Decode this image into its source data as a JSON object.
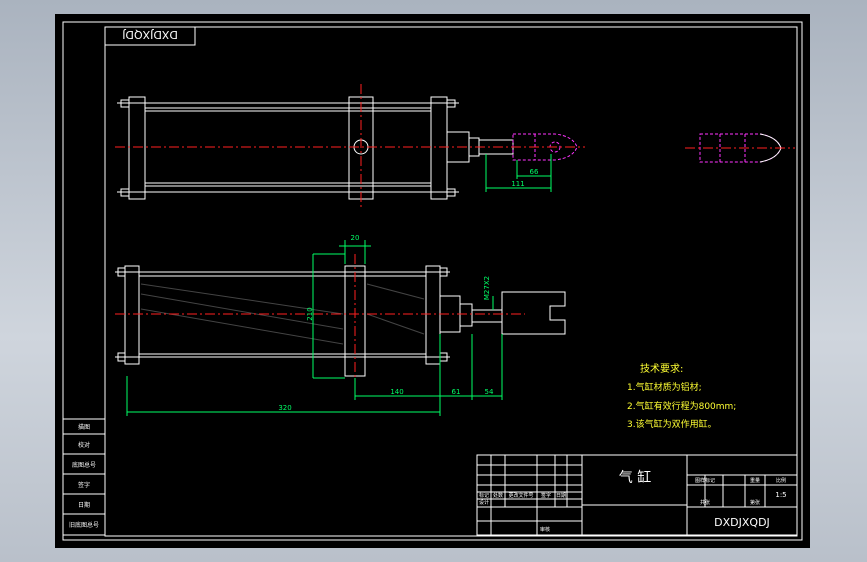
{
  "drawing": {
    "code_box_top": "DXDJXQDJ",
    "title": "气 缸",
    "drawing_code": "DXDJXQDJ",
    "scale": "1:5",
    "tech_requirements": {
      "heading": "技术要求:",
      "items": [
        "1.气缸材质为铝材;",
        "2.气缸有效行程为800mm;",
        "3.该气缸为双作用缸。"
      ]
    },
    "dimensions": {
      "top_view": [
        "111",
        "66"
      ],
      "front_view": [
        "320",
        "140",
        "61",
        "54",
        "210",
        "20",
        "M27X2"
      ]
    },
    "side_table_labels": [
      "描图",
      "校对",
      "底图总号",
      "签字",
      "日期",
      "旧底图总号"
    ],
    "title_block_labels": [
      "标记",
      "处数",
      "更改文件号",
      "签字",
      "日期",
      "设计",
      "审核",
      "图样标记",
      "重量",
      "比例",
      "共张",
      "第张"
    ]
  },
  "colors": {
    "background": "#000000",
    "line": "#ffffff",
    "centerline": "#ff2020",
    "dimension": "#00ff66",
    "hidden": "#ff33ff",
    "note_text": "#ffff33",
    "blue": "#4466ff"
  }
}
